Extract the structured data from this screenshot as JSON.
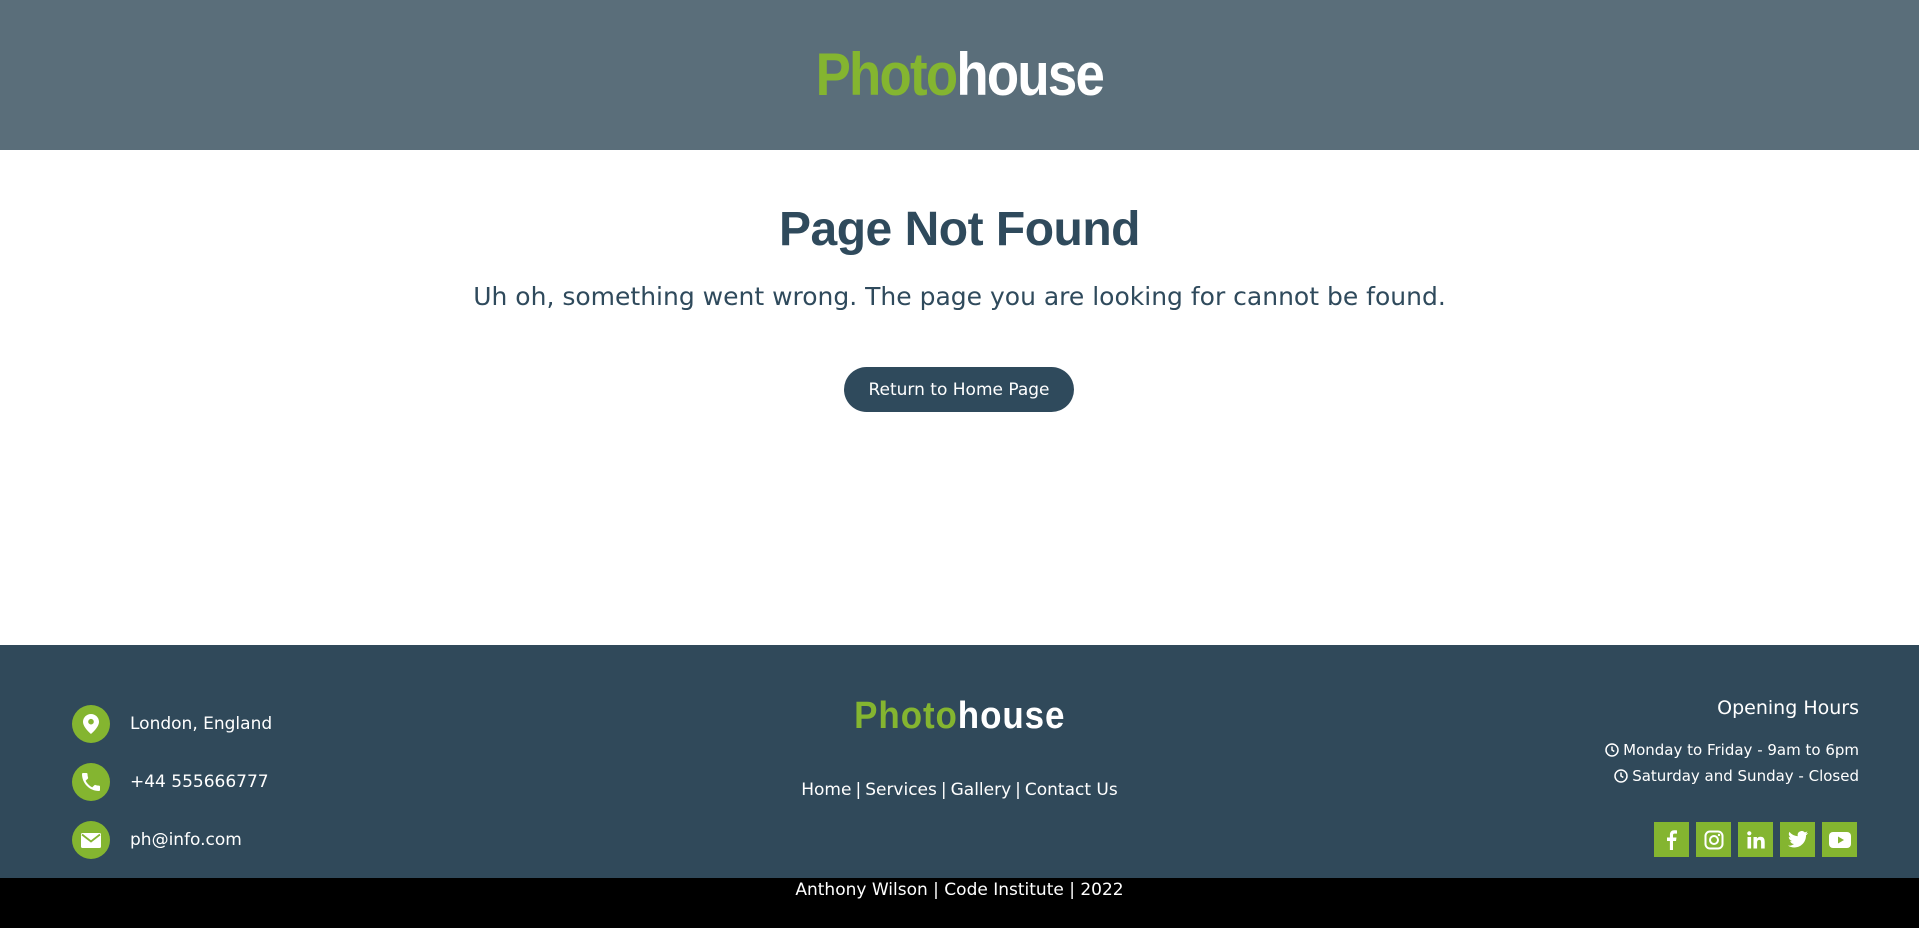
{
  "header": {
    "logo_part1": "Photo",
    "logo_part2": "house"
  },
  "main": {
    "title": "Page Not Found",
    "message": "Uh oh, something went wrong. The page you are looking for cannot be found.",
    "button_label": "Return to Home Page"
  },
  "footer": {
    "contacts": [
      {
        "icon": "map-marker-icon",
        "text": "London, England"
      },
      {
        "icon": "phone-icon",
        "text": "+44 555666777"
      },
      {
        "icon": "envelope-icon",
        "text": "ph@info.com"
      }
    ],
    "logo_part1": "Photo",
    "logo_part2": "house",
    "nav": [
      "Home",
      "Services",
      "Gallery",
      "Contact Us"
    ],
    "nav_separator": "|",
    "hours_title": "Opening Hours",
    "hours": [
      "Monday to Friday - 9am to 6pm",
      "Saturday and Sunday - Closed"
    ],
    "socials": [
      "facebook-icon",
      "instagram-icon",
      "linkedin-icon",
      "twitter-icon",
      "youtube-icon"
    ]
  },
  "bottom_bar": {
    "text": "Anthony Wilson | Code Institute | 2022"
  },
  "colors": {
    "header_bg": "#5a6e7a",
    "footer_bg": "#30495a",
    "accent_green": "#84b530",
    "title_text": "#2f4a5c",
    "bottom_bar_bg": "#000000"
  }
}
